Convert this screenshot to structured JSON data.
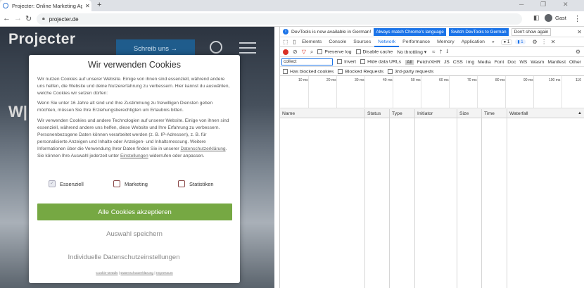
{
  "browser": {
    "tab_title": "Projecter: Online Marketing Agentur",
    "url": "projecter.de",
    "profile": "Gast"
  },
  "site": {
    "logo": "Projecter",
    "cta": "Schreib uns →",
    "headline": "W|"
  },
  "cookie": {
    "title": "Wir verwenden Cookies",
    "p1": "Wir nutzen Cookies auf unserer Website. Einige von ihnen sind essenziell, während andere uns helfen, die Website und deine Nutzererfahrung zu verbessern. Hier kannst du auswählen, welche Cookies wir setzen dürfen:",
    "p2": "Wenn Sie unter 16 Jahre alt sind und Ihre Zustimmung zu freiwilligen Diensten geben möchten, müssen Sie Ihre Erziehungsberechtigten um Erlaubnis bitten.",
    "p3_start": "Wir verwenden Cookies und andere Technologien auf unserer Website. Einige von ihnen sind essenziell, während andere uns helfen, diese Website und Ihre Erfahrung zu verbessern. Personenbezogene Daten können verarbeitet werden (z. B. IP-Adressen), z. B. für personalisierte Anzeigen und Inhalte oder Anzeigen- und Inhaltsmessung. Weitere Informationen über die Verwendung Ihrer Daten finden Sie in unserer ",
    "p3_link1": "Datenschutzerklärung",
    "p3_mid": ". Sie können Ihre Auswahl jederzeit unter ",
    "p3_link2": "Einstellungen",
    "p3_end": " widerrufen oder anpassen.",
    "checkboxes": [
      {
        "label": "Essenziell",
        "checked": true
      },
      {
        "label": "Marketing",
        "checked": false
      },
      {
        "label": "Statistiken",
        "checked": false
      }
    ],
    "accept_all": "Alle Cookies akzeptieren",
    "save": "Auswahl speichern",
    "individual": "Individuelle Datenschutzeinstellungen",
    "footer": [
      "Cookie-Details",
      "Datenschutzerklärung",
      "Impressum"
    ],
    "accent": "#76a843"
  },
  "devtools": {
    "info": "DevTools is now available in German!",
    "btn_match": "Always match Chrome's language",
    "btn_switch": "Switch DevTools to German",
    "btn_dont": "Don't show again",
    "panels": [
      "Elements",
      "Console",
      "Sources",
      "Network",
      "Performance",
      "Memory",
      "Application",
      "»"
    ],
    "active_panel": "Network",
    "badge_errors": "1",
    "badge_messages": "1",
    "preserve_log": "Preserve log",
    "disable_cache": "Disable cache",
    "throttle": "No throttling",
    "filter_value": "collect",
    "invert": "Invert",
    "hide_data": "Hide data URLs",
    "types": [
      "All",
      "Fetch/XHR",
      "JS",
      "CSS",
      "Img",
      "Media",
      "Font",
      "Doc",
      "WS",
      "Wasm",
      "Manifest",
      "Other"
    ],
    "blocked_cookies": "Has blocked cookies",
    "blocked_requests": "Blocked Requests",
    "third_party": "3rd-party requests",
    "ticks": [
      "10 ms",
      "20 ms",
      "30 ms",
      "40 ms",
      "50 ms",
      "60 ms",
      "70 ms",
      "80 ms",
      "90 ms",
      "100 ms",
      "110"
    ],
    "columns": [
      "Name",
      "Status",
      "Type",
      "Initiator",
      "Size",
      "Time",
      "Waterfall"
    ]
  }
}
